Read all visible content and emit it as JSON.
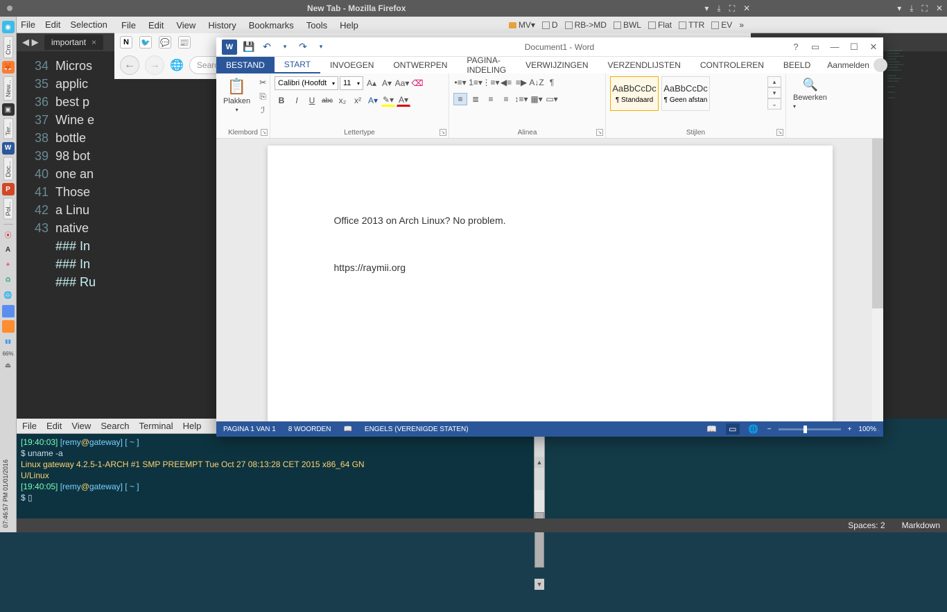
{
  "system_titlebar": {
    "title": "New Tab - Mozilla Firefox",
    "ctrl_down1": "▾",
    "ctrl_down2": "⤓",
    "ctrl_max": "⛶",
    "ctrl_close": "✕"
  },
  "left_dock": {
    "tabs": [
      "Cro...",
      "New...",
      "Ter...",
      "Doc...",
      "Pol..."
    ],
    "time_vertical": "07:46:57 PM 01/01/2016",
    "pct": "66%"
  },
  "editor": {
    "menu": [
      "File",
      "Edit",
      "Selection"
    ],
    "tab_name": "important",
    "tab_close": "×",
    "arrows": "◀ ▶",
    "gutter": [
      "",
      "",
      "",
      "",
      "",
      "",
      "",
      "34",
      "35",
      "",
      "",
      "36",
      "37",
      "38",
      "39",
      "40",
      "41",
      "42",
      "43"
    ],
    "lines": [
      "Micros",
      "applic",
      "best p",
      "Wine e",
      "bottle",
      "98 bot",
      "one an",
      "",
      "Those ",
      "a Linu",
      "native",
      "",
      "### In",
      "",
      "",
      "### In",
      "",
      "",
      "### Ru"
    ]
  },
  "terminal": {
    "menu": [
      "File",
      "Edit",
      "View",
      "Search",
      "Terminal",
      "Help"
    ],
    "l1_ts": "[19:40:03]",
    "l1_user": " [remy",
    "l1_at": "@",
    "l1_host": "gateway",
    "l1_rest": "] [ ~ ]",
    "l2": "$ uname -a",
    "l3": "Linux gateway 4.2.5-1-ARCH #1 SMP PREEMPT Tue Oct 27 08:13:28 CET 2015 x86_64 GN",
    "l3b": "U/Linux",
    "l4_ts": "[19:40:05]",
    "l4_user": " [remy",
    "l4_at": "@",
    "l4_host": "gateway",
    "l4_rest": "] [ ~ ]",
    "l5": "$ ▯"
  },
  "global_status": {
    "spaces": "Spaces: 2",
    "lang": "Markdown"
  },
  "firefox": {
    "menu": [
      "File",
      "Edit",
      "View",
      "History",
      "Bookmarks",
      "Tools",
      "Help"
    ],
    "bookmarks": [
      "MV▾",
      "D",
      "RB->MD",
      "BWL",
      "Flat",
      "TTR",
      "EV"
    ],
    "more": "»",
    "tab_icons": [
      "N",
      "🐦",
      "💬",
      "📰"
    ],
    "nav_back": "←",
    "nav_fwd": "→",
    "globe": "🌐",
    "url_placeholder": "Search or enter address"
  },
  "word": {
    "title": "Document1 - Word",
    "help": "?",
    "ribbon_opts": "▭",
    "min": "―",
    "max": "☐",
    "close": "✕",
    "qat": {
      "save": "💾",
      "undo": "↶",
      "redo": "↷",
      "more": "▾"
    },
    "tabs": {
      "file": "BESTAND",
      "start": "START",
      "invoegen": "INVOEGEN",
      "ontwerpen": "ONTWERPEN",
      "pagina": "PAGINA-INDELING",
      "verwijzingen": "VERWIJZINGEN",
      "verzend": "VERZENDLIJSTEN",
      "controleren": "CONTROLEREN",
      "beeld": "BEELD"
    },
    "login": "Aanmelden",
    "ribbon": {
      "klembord": {
        "label": "Klembord",
        "plakken": "Plakken",
        "plakken_arrow": "▾",
        "cut": "✂",
        "copy": "⎘",
        "painter": "ℐ"
      },
      "lettertype": {
        "label": "Lettertype",
        "font": "Calibri (Hoofdt",
        "font_arrow": "▾",
        "size": "11",
        "size_arrow": "▾",
        "grow": "A▴",
        "shrink": "A▾",
        "case": "Aa▾",
        "clear": "⌫",
        "bold": "B",
        "italic": "I",
        "underline": "U",
        "strike": "abc",
        "sub": "x₂",
        "sup": "x²",
        "effects": "A▾",
        "highlight": "✎▾",
        "color": "A▾"
      },
      "alinea": {
        "label": "Alinea",
        "bullets": "•≡▾",
        "numbers": "1≡▾",
        "multi": "⋮≡▾",
        "out": "◀≡",
        "ind": "≡▶",
        "sort": "A↓Z",
        "marks": "¶",
        "al": "≡",
        "ac": "≣",
        "ar": "≡",
        "aj": "≡",
        "spacing": "↕≡▾",
        "shade": "▦▾",
        "border": "▭▾"
      },
      "stijlen": {
        "label": "Stijlen",
        "standaard_prev": "AaBbCcDc",
        "standaard": "¶ Standaard",
        "geen_prev": "AaBbCcDc",
        "geen": "¶ Geen afstan",
        "up": "▴",
        "dn": "▾",
        "more": "⌄"
      },
      "bewerken": {
        "label": "",
        "btn": "Bewerken",
        "arrow": "▾",
        "find": "🔍"
      }
    },
    "document": {
      "p1": "Office 2013 on Arch Linux? No problem.",
      "p2": "https://raymii.org"
    },
    "status": {
      "pagina": "PAGINA 1 VAN 1",
      "woorden": "8 WOORDEN",
      "spell_icon": "📖",
      "taal": "ENGELS (VERENIGDE STATEN)",
      "view_read": "📖",
      "view_print": "▭",
      "view_web": "🌐",
      "zoom_minus": "−",
      "zoom_plus": "+",
      "zoom": "100%"
    }
  }
}
